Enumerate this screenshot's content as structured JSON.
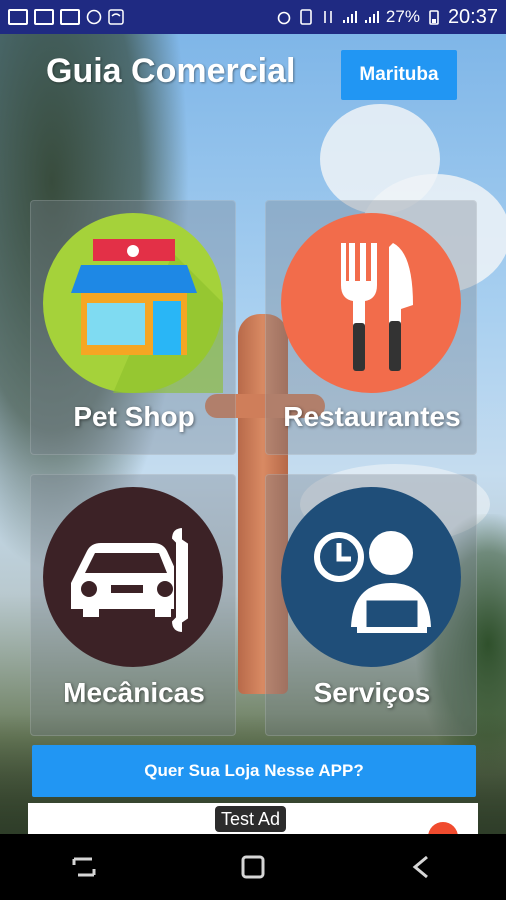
{
  "status_bar": {
    "battery": "27%",
    "time": "20:37"
  },
  "header": {
    "title": "Guia Comercial",
    "city_button": "Marituba"
  },
  "categories": [
    {
      "label": "Pet Shop",
      "icon": "pet-shop-icon",
      "color": "#a5d23a"
    },
    {
      "label": "Restaurantes",
      "icon": "cutlery-icon",
      "color": "#f26c4b"
    },
    {
      "label": "Mecânicas",
      "icon": "car-wrench-icon",
      "color": "#3c2226"
    },
    {
      "label": "Serviços",
      "icon": "service-worker-icon",
      "color": "#1f4e79"
    }
  ],
  "cta": {
    "label": "Quer Sua Loja Nesse APP?"
  },
  "ad": {
    "label": "Test Ad"
  },
  "colors": {
    "accent": "#2196f3",
    "status_bar": "#1f2a82"
  }
}
